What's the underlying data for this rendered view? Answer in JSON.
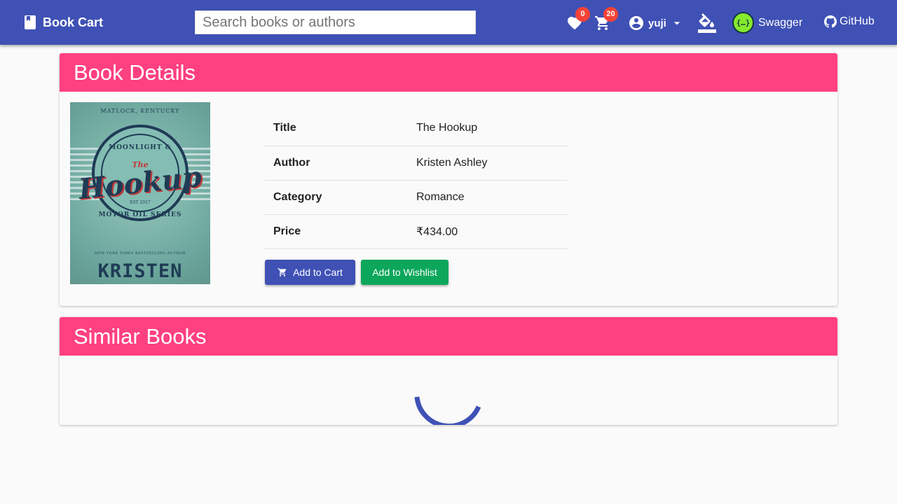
{
  "header": {
    "brand": "Book Cart",
    "search_placeholder": "Search books or authors",
    "wishlist_count": "0",
    "cart_count": "20",
    "username": "yuji",
    "swagger_label": "Swagger",
    "swagger_logo_text": "{…}",
    "github_label": "GitHub"
  },
  "book_details": {
    "heading": "Book Details",
    "cover_text": {
      "location": "MATLOCK, KENTUCKY",
      "series_top": "MOONLIGHT &",
      "the": "The",
      "title": "Hookup",
      "est": "EST 2017",
      "series_bottom": "MOTOR OIL SERIES",
      "tagline": "NEW YORK TIMES BESTSELLING AUTHOR",
      "author": "KRISTEN ASHLEY"
    },
    "rows": [
      {
        "label": "Title",
        "value": "The Hookup"
      },
      {
        "label": "Author",
        "value": "Kristen Ashley"
      },
      {
        "label": "Category",
        "value": "Romance"
      },
      {
        "label": "Price",
        "value": "₹434.00"
      }
    ],
    "add_to_cart_label": "Add to Cart",
    "add_to_wishlist_label": "Add to Wishlist"
  },
  "similar_books": {
    "heading": "Similar Books"
  },
  "colors": {
    "primary": "#3f51b5",
    "accent": "#ff4081",
    "badge": "#f44336",
    "wishlist_button": "#0da75b"
  },
  "icons": [
    "book-icon",
    "heart-icon",
    "cart-icon",
    "account-icon",
    "dropdown-icon",
    "paint-bucket-icon",
    "swagger-icon",
    "github-icon"
  ]
}
